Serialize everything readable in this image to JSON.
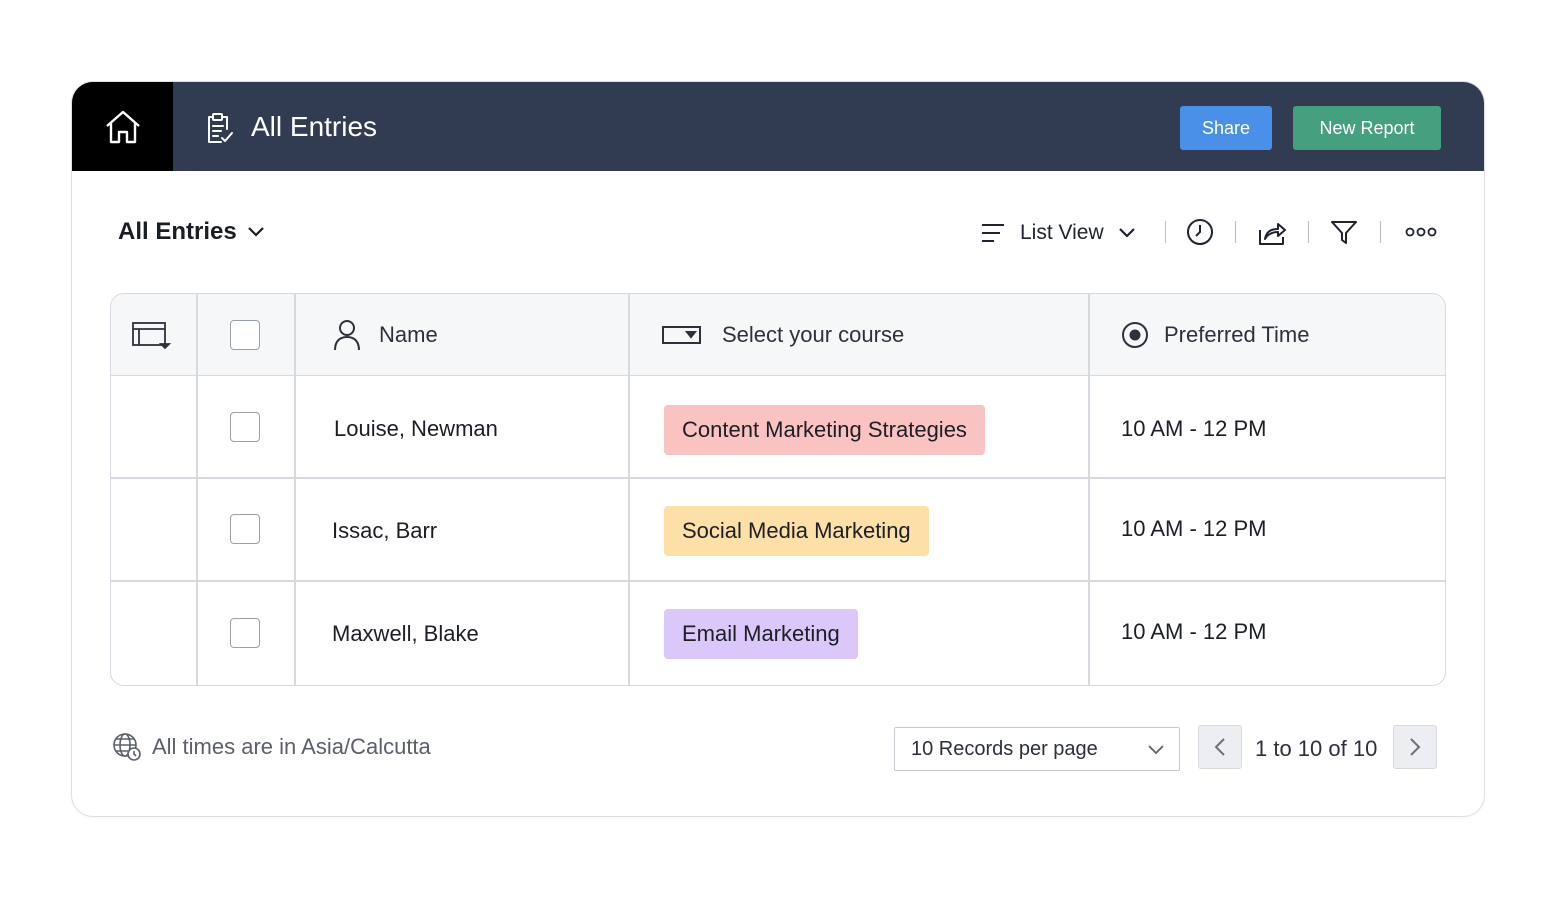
{
  "header": {
    "title": "All Entries",
    "share_label": "Share",
    "new_report_label": "New Report",
    "home_icon": "home-icon",
    "title_icon": "clipboard-check-icon"
  },
  "toolbar": {
    "view_title": "All Entries",
    "list_view_label": "List View",
    "icons": [
      "list-lines-icon",
      "clock-icon",
      "share-arrow-icon",
      "filter-icon",
      "more-options-icon"
    ]
  },
  "table": {
    "columns": [
      {
        "label": "Name",
        "icon": "person-icon"
      },
      {
        "label": "Select your course",
        "icon": "dropdown-field-icon"
      },
      {
        "label": "Preferred Time",
        "icon": "radio-icon"
      }
    ],
    "rows": [
      {
        "name": "Louise, Newman",
        "course": "Content Marketing Strategies",
        "course_color": "#fbc2c2",
        "time": "10 AM - 12 PM"
      },
      {
        "name": "Issac, Barr",
        "course": "Social Media Marketing",
        "course_color": "#fde0a8",
        "time": "10 AM - 12 PM"
      },
      {
        "name": "Maxwell, Blake",
        "course": "Email Marketing",
        "course_color": "#dcc7fa",
        "time": "10 AM - 12 PM"
      }
    ]
  },
  "footer": {
    "timezone_text": "All times are in Asia/Calcutta",
    "records_per_page": "10 Records per page",
    "pagination_info": "1 to 10 of 10"
  },
  "colors": {
    "topbar": "#313b51",
    "share": "#4a90e8",
    "new_report": "#44a07f"
  }
}
